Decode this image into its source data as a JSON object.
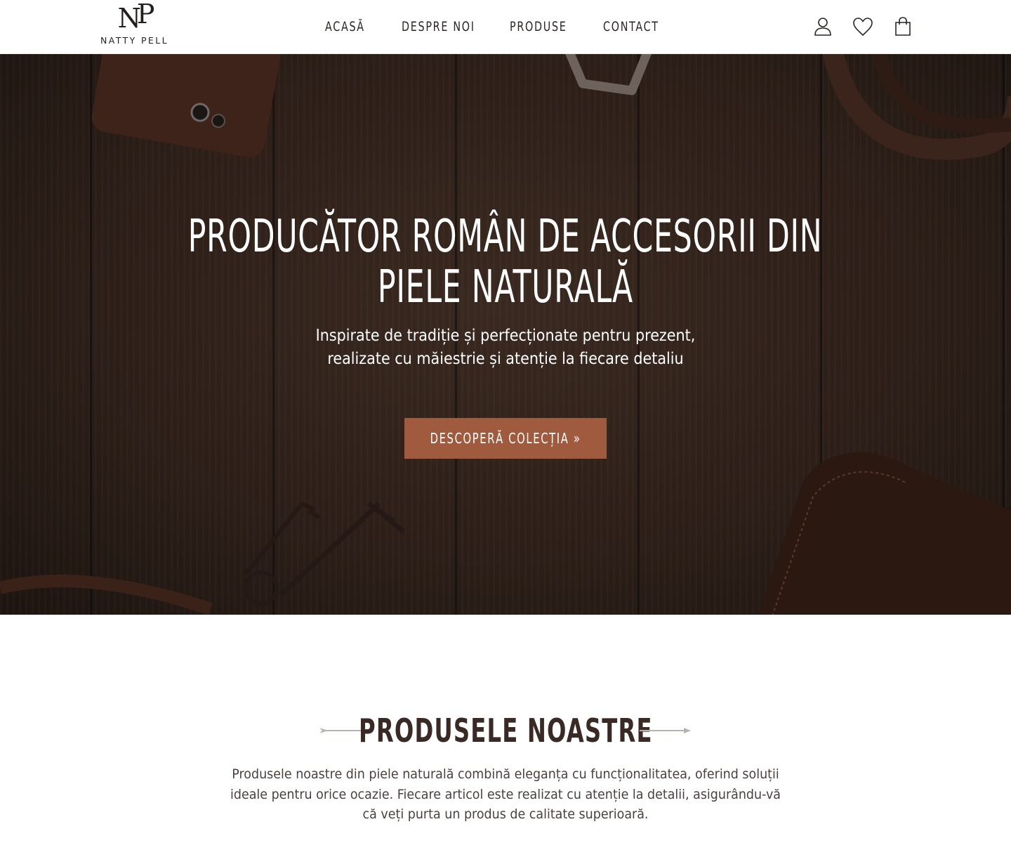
{
  "header": {
    "logo": {
      "mark": "NP",
      "name": "NATTY PELL"
    },
    "nav": [
      {
        "label": "ACASĂ"
      },
      {
        "label": "DESPRE NOI"
      },
      {
        "label": "PRODUSE"
      },
      {
        "label": "CONTACT"
      }
    ],
    "icons": [
      "user-icon",
      "heart-icon",
      "shopping-bag-icon"
    ]
  },
  "hero": {
    "title_line1": "PRODUCĂTOR ROMÂN DE ACCESORII DIN",
    "title_line2": "PIELE NATURALĂ",
    "subtitle_line1": "Inspirate de tradiție și perfecționate pentru prezent,",
    "subtitle_line2": "realizate cu măiestrie și atenție la fiecare detaliu",
    "cta_label": "DESCOPERĂ COLECȚIA »",
    "cta_color": "#a05a3d"
  },
  "products_section": {
    "title": "PRODUSELE NOASTRE",
    "description": "Produsele noastre din piele naturală combină eleganța cu funcționalitatea, oferind soluții ideale pentru orice ocazie. Fiecare articol este realizat cu atenție la detalii, asigurându-vă că veți purta un produs de calitate superioară."
  }
}
